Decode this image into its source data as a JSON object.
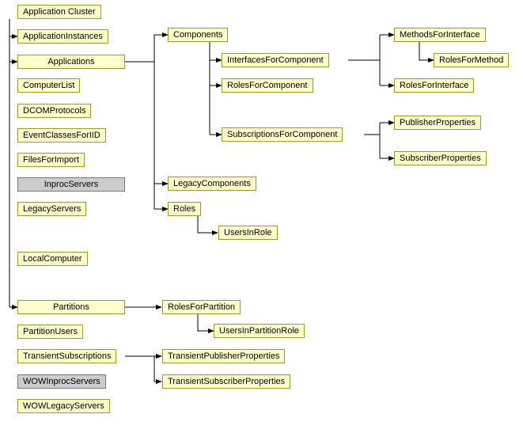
{
  "nodes": {
    "applicationCluster": "Application Cluster",
    "applicationInstances": "ApplicationInstances",
    "applications": "Applications",
    "computerList": "ComputerList",
    "dcomProtocols": "DCOMProtocols",
    "eventClassesForIID": "EventClassesForIID",
    "filesForImport": "FilesForImport",
    "inprocServers": "InprocServers",
    "legacyServers": "LegacyServers",
    "localComputer": "LocalComputer",
    "partitions": "Partitions",
    "partitionUsers": "PartitionUsers",
    "transientSubscriptions": "TransientSubscriptions",
    "wowInprocServers": "WOWInprocServers",
    "wowLegacyServers": "WOWLegacyServers",
    "components": "Components",
    "legacyComponents": "LegacyComponents",
    "roles": "Roles",
    "usersInRole": "UsersInRole",
    "interfacesForComponent": "InterfacesForComponent",
    "rolesForComponent": "RolesForComponent",
    "subscriptionsForComponent": "SubscriptionsForComponent",
    "methodsForInterface": "MethodsForInterface",
    "rolesForInterface": "RolesForInterface",
    "rolesForMethod": "RolesForMethod",
    "publisherProperties": "PublisherProperties",
    "subscriberProperties": "SubscriberProperties",
    "rolesForPartition": "RolesForPartition",
    "usersInPartitionRole": "UsersInPartitionRole",
    "transientPublisherProperties": "TransientPublisherProperties",
    "transientSubscriberProperties": "TransientSubscriberProperties"
  },
  "colors": {
    "nodeFill": "#ffffcc",
    "nodeBorder": "#999933",
    "grayFill": "#cccccc"
  },
  "diagram_structure": {
    "description": "Hierarchical tree of COM+ administration collections. Left column lists top-level collections under 'Application Cluster'. Arrows indicate parent→child collection containment.",
    "edges": [
      [
        "ApplicationCluster",
        "ApplicationInstances"
      ],
      [
        "ApplicationCluster",
        "Applications"
      ],
      [
        "ApplicationCluster",
        "Partitions"
      ],
      [
        "Applications",
        "Components"
      ],
      [
        "Applications",
        "LegacyComponents"
      ],
      [
        "Applications",
        "Roles"
      ],
      [
        "Roles",
        "UsersInRole"
      ],
      [
        "Components",
        "InterfacesForComponent"
      ],
      [
        "Components",
        "RolesForComponent"
      ],
      [
        "Components",
        "SubscriptionsForComponent"
      ],
      [
        "InterfacesForComponent",
        "MethodsForInterface"
      ],
      [
        "InterfacesForComponent",
        "RolesForInterface"
      ],
      [
        "MethodsForInterface",
        "RolesForMethod"
      ],
      [
        "SubscriptionsForComponent",
        "PublisherProperties"
      ],
      [
        "SubscriptionsForComponent",
        "SubscriberProperties"
      ],
      [
        "Partitions",
        "RolesForPartition"
      ],
      [
        "RolesForPartition",
        "UsersInPartitionRole"
      ],
      [
        "TransientSubscriptions",
        "TransientPublisherProperties"
      ],
      [
        "TransientSubscriptions",
        "TransientSubscriberProperties"
      ]
    ],
    "gray_nodes": [
      "InprocServers",
      "WOWInprocServers"
    ]
  }
}
